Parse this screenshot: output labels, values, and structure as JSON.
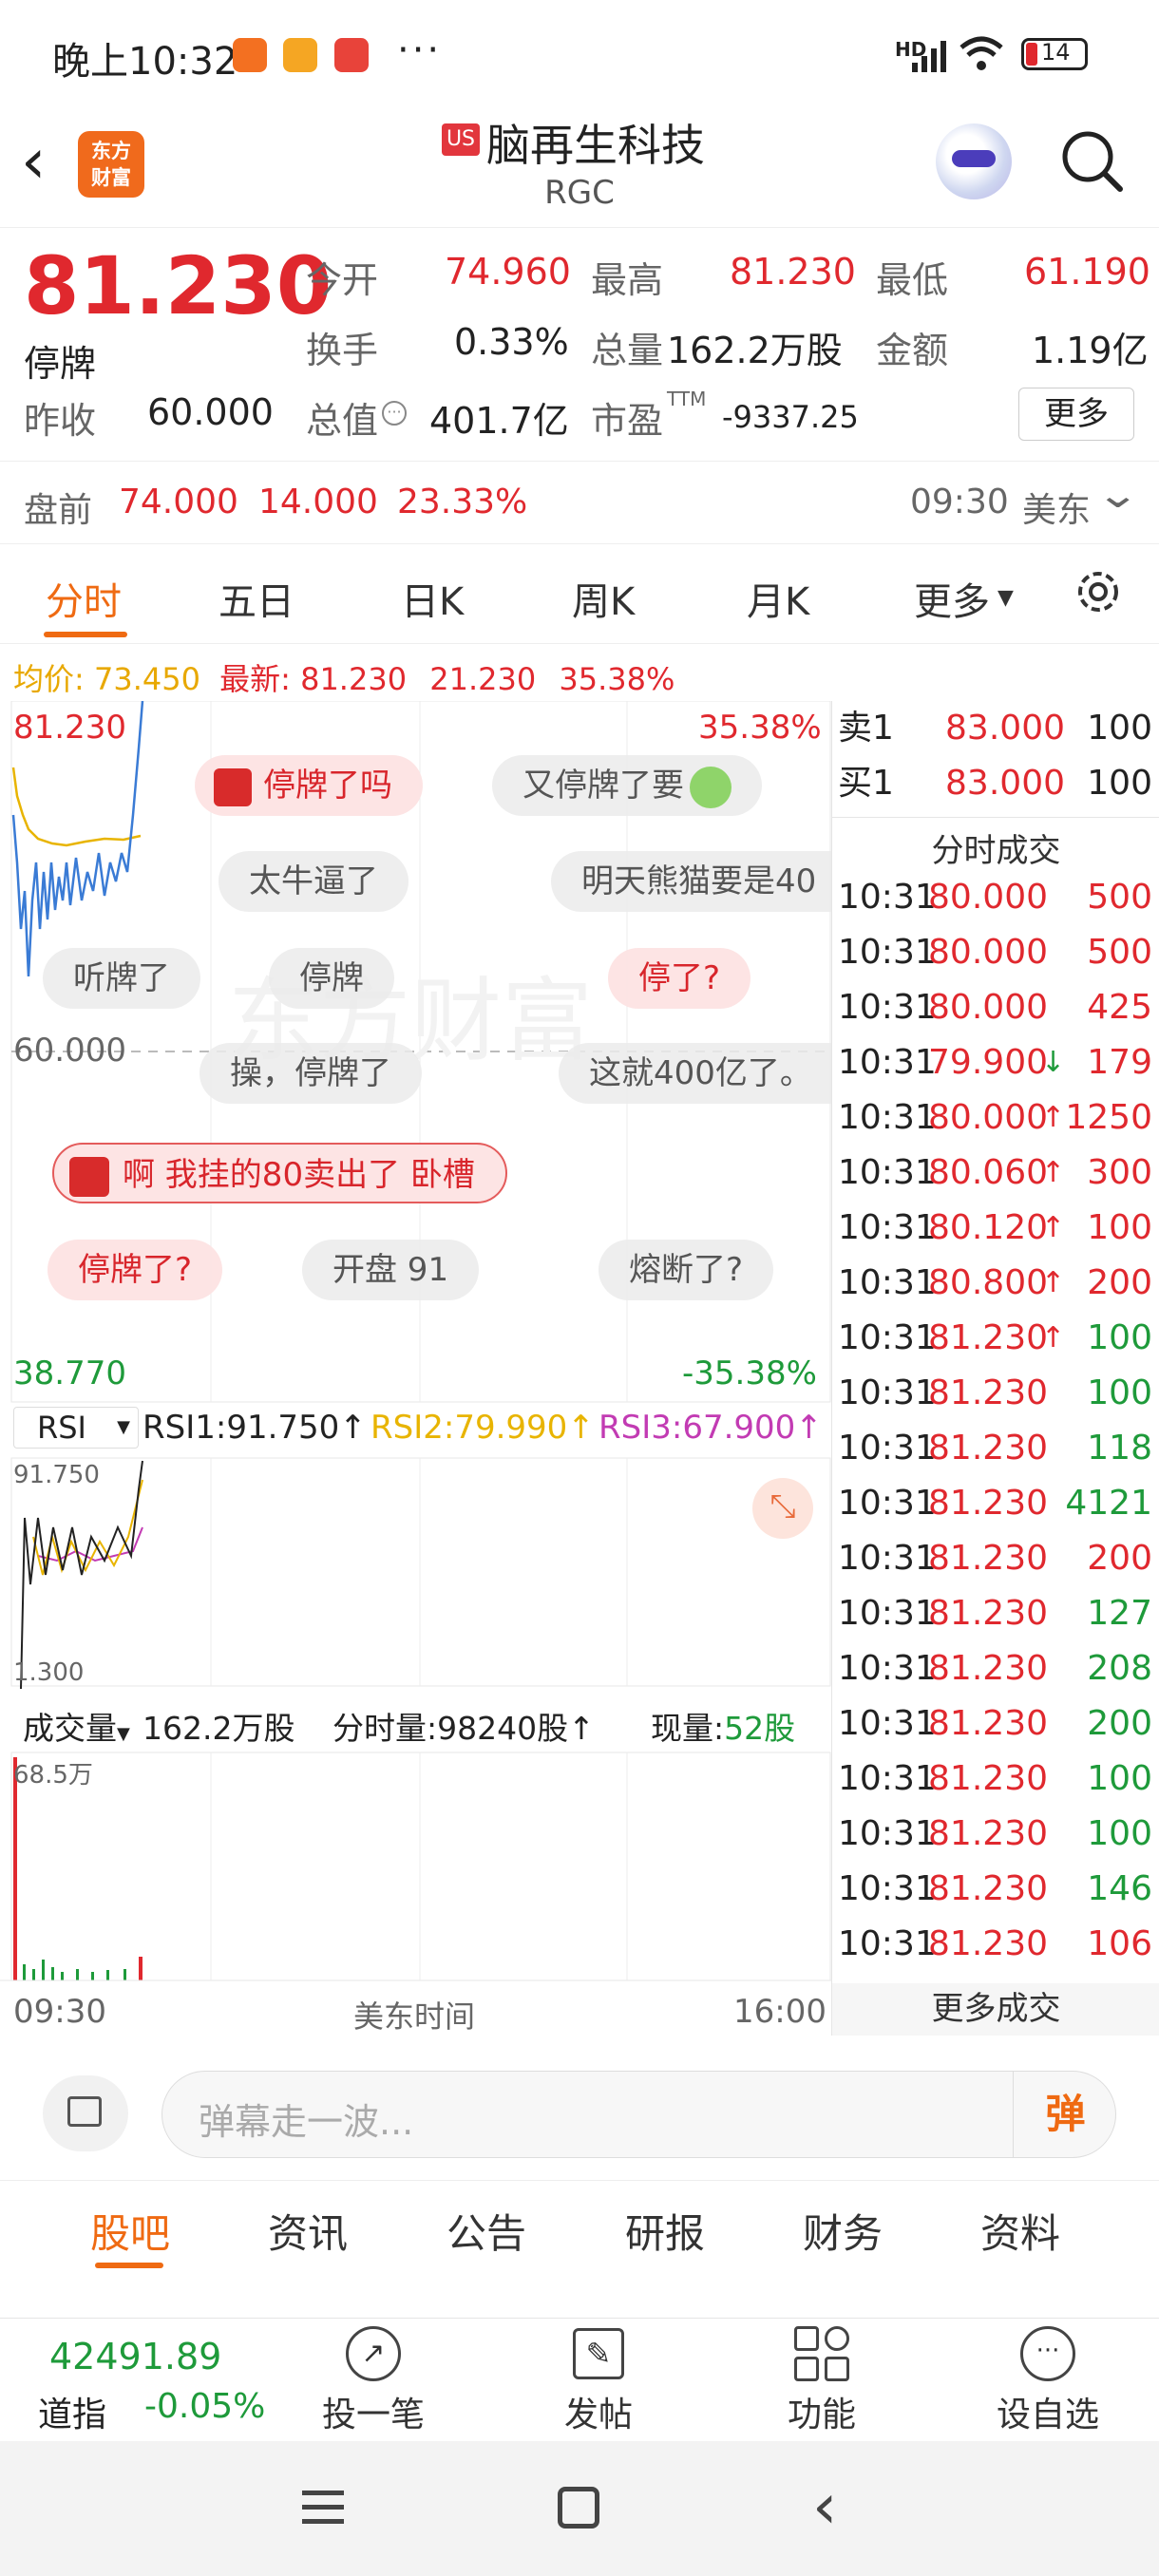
{
  "status_bar": {
    "time": "晚上10:32",
    "dots": "···",
    "network": "HD",
    "battery": "14"
  },
  "header": {
    "logo_text_1": "东方",
    "logo_text_2": "财富",
    "market_badge": "US",
    "stock_name": "脑再生科技",
    "stock_code": "RGC"
  },
  "quote": {
    "price": "81.230",
    "status": "停牌",
    "open_label": "今开",
    "open": "74.960",
    "high_label": "最高",
    "high": "81.230",
    "low_label": "最低",
    "low": "61.190",
    "turnover_label": "换手",
    "turnover": "0.33%",
    "volume_label": "总量",
    "volume": "162.2万股",
    "amount_label": "金额",
    "amount": "1.19亿",
    "prev_close_label": "昨收",
    "prev_close": "60.000",
    "mktcap_label": "总值",
    "mktcap": "401.7亿",
    "pe_label": "市盈",
    "pe_sup": "TTM",
    "pe": "-9337.25",
    "more_label": "更多"
  },
  "premarket": {
    "label": "盘前",
    "price": "74.000",
    "change": "14.000",
    "pct": "23.33%",
    "time": "09:30",
    "zone": "美东"
  },
  "tabs": [
    "分时",
    "五日",
    "日K",
    "周K",
    "月K",
    "更多"
  ],
  "chart": {
    "avg_label": "均价:",
    "avg": "73.450",
    "latest_label": "最新:",
    "latest": "81.230",
    "chg": "21.230",
    "pct": "35.38%",
    "top_price": "81.230",
    "top_pct": "35.38%",
    "base_price": "60.000",
    "bottom_price": "38.770",
    "bottom_pct": "-35.38%",
    "rsi_label": "RSI",
    "rsi1": "RSI1:91.750",
    "rsi2": "RSI2:79.990",
    "rsi3": "RSI3:67.900",
    "rsi_top": "91.750",
    "rsi_bottom": "1.300",
    "vol_label": "成交量",
    "vol_total": "162.2万股",
    "vol_tick": "分时量:98240股",
    "vol_now_label": "现量:",
    "vol_now": "52股",
    "vol_max": "68.5万",
    "time_start": "09:30",
    "time_mid": "美东时间",
    "time_end": "16:00",
    "watermark": "东方财富"
  },
  "danmaku": [
    {
      "text": "停牌了吗"
    },
    {
      "text": "又停牌了要"
    },
    {
      "text": "太牛逼了"
    },
    {
      "text": "明天熊猫要是40"
    },
    {
      "text": "听牌了"
    },
    {
      "text": "停牌"
    },
    {
      "text": "停了?"
    },
    {
      "text": "操，停牌了"
    },
    {
      "text": "这就400亿了。"
    },
    {
      "text": "啊 我挂的80卖出了 卧槽"
    },
    {
      "text": "停牌了?"
    },
    {
      "text": "开盘 91"
    },
    {
      "text": "熔断了?"
    }
  ],
  "orderbook": {
    "sell_label": "卖1",
    "sell_price": "83.000",
    "sell_vol": "100",
    "buy_label": "买1",
    "buy_price": "83.000",
    "buy_vol": "100",
    "title": "分时成交"
  },
  "trades": [
    {
      "time": "10:31",
      "price": "80.000",
      "arrow": "",
      "vol": "500",
      "vc": "red"
    },
    {
      "time": "10:31",
      "price": "80.000",
      "arrow": "",
      "vol": "500",
      "vc": "red"
    },
    {
      "time": "10:31",
      "price": "80.000",
      "arrow": "",
      "vol": "425",
      "vc": "red"
    },
    {
      "time": "10:31",
      "price": "79.900",
      "arrow": "↓",
      "vol": "179",
      "vc": "red"
    },
    {
      "time": "10:31",
      "price": "80.000",
      "arrow": "↑",
      "vol": "1250",
      "vc": "red"
    },
    {
      "time": "10:31",
      "price": "80.060",
      "arrow": "↑",
      "vol": "300",
      "vc": "red"
    },
    {
      "time": "10:31",
      "price": "80.120",
      "arrow": "↑",
      "vol": "100",
      "vc": "red"
    },
    {
      "time": "10:31",
      "price": "80.800",
      "arrow": "↑",
      "vol": "200",
      "vc": "red"
    },
    {
      "time": "10:31",
      "price": "81.230",
      "arrow": "↑",
      "vol": "100",
      "vc": "green"
    },
    {
      "time": "10:31",
      "price": "81.230",
      "arrow": "",
      "vol": "100",
      "vc": "green"
    },
    {
      "time": "10:31",
      "price": "81.230",
      "arrow": "",
      "vol": "118",
      "vc": "green"
    },
    {
      "time": "10:31",
      "price": "81.230",
      "arrow": "",
      "vol": "4121",
      "vc": "green"
    },
    {
      "time": "10:31",
      "price": "81.230",
      "arrow": "",
      "vol": "200",
      "vc": "red"
    },
    {
      "time": "10:31",
      "price": "81.230",
      "arrow": "",
      "vol": "127",
      "vc": "green"
    },
    {
      "time": "10:31",
      "price": "81.230",
      "arrow": "",
      "vol": "208",
      "vc": "green"
    },
    {
      "time": "10:31",
      "price": "81.230",
      "arrow": "",
      "vol": "200",
      "vc": "green"
    },
    {
      "time": "10:31",
      "price": "81.230",
      "arrow": "",
      "vol": "100",
      "vc": "green"
    },
    {
      "time": "10:31",
      "price": "81.230",
      "arrow": "",
      "vol": "100",
      "vc": "green"
    },
    {
      "time": "10:31",
      "price": "81.230",
      "arrow": "",
      "vol": "146",
      "vc": "green"
    },
    {
      "time": "10:31",
      "price": "81.230",
      "arrow": "",
      "vol": "106",
      "vc": "red"
    }
  ],
  "more_trades": "更多成交",
  "danmu_input": {
    "placeholder": "弹幕走一波...",
    "send": "弹"
  },
  "subtabs": [
    "股吧",
    "资讯",
    "公告",
    "研报",
    "财务",
    "资料"
  ],
  "bottom_bar": {
    "index_value": "42491.89",
    "index_name": "道指",
    "index_pct": "-0.05%",
    "items": [
      "投一笔",
      "发帖",
      "功能",
      "设自选"
    ]
  },
  "colors": {
    "up": "#e0282e",
    "down": "#1e9a3a",
    "accent": "#ef6a12",
    "avg_line": "#e8b400",
    "price_line": "#3a7bd5"
  }
}
